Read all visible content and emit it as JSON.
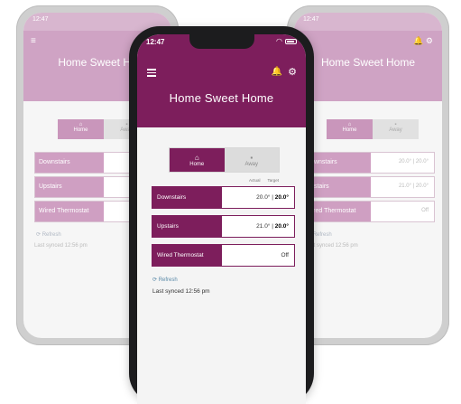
{
  "status": {
    "time": "12:47"
  },
  "app": {
    "title": "Home Sweet Home"
  },
  "mode": {
    "home_label": "Home",
    "away_label": "Away"
  },
  "columns": {
    "actual": "Actual",
    "target": "Target"
  },
  "zones": [
    {
      "name": "Downstairs",
      "actual": "20.0°",
      "target": "20.0°"
    },
    {
      "name": "Upstairs",
      "actual": "21.0°",
      "target": "20.0°"
    },
    {
      "name": "Wired Thermostat",
      "state": "Off"
    }
  ],
  "refresh_label": "Refresh",
  "last_synced": "Last synced 12:56 pm",
  "background_phones": {
    "left": {
      "title": "Home Sweet Ho",
      "zones": [
        "Downstairs",
        "Upstairs",
        "Wired Thermostat"
      ],
      "refresh_label": "Refresh",
      "last_synced": "Last synced 12:56 pm"
    },
    "right": {
      "title": "Home Sweet Home",
      "zones": [
        "Downstairs",
        "Upstairs",
        "Wired Thermostat"
      ],
      "values": [
        "20.0° | 20.0°",
        "21.0° | 20.0°",
        "Off"
      ],
      "refresh_label": "Refresh",
      "last_synced": "Last synced 12:56 pm"
    }
  },
  "colors": {
    "brand": "#7d1e5c",
    "screen_bg": "#f4f4f4",
    "link": "#5a8aa8"
  },
  "icons": [
    "menu-icon",
    "bell-icon",
    "gear-icon",
    "home-icon",
    "briefcase-icon",
    "refresh-icon"
  ]
}
